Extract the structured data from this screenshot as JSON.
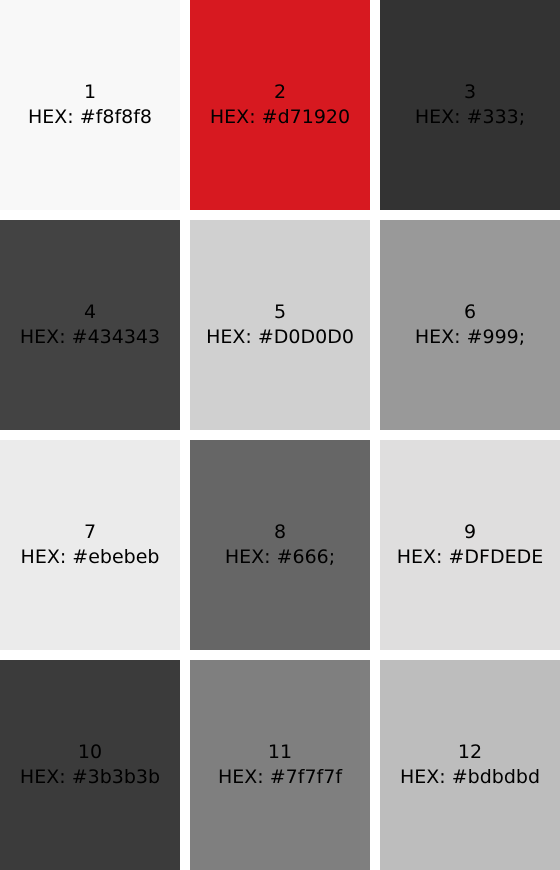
{
  "hex_prefix": "HEX:",
  "swatches": [
    {
      "number": "1",
      "hex": "#f8f8f8",
      "color": "#f8f8f8"
    },
    {
      "number": "2",
      "hex": "#d71920",
      "color": "#d71920"
    },
    {
      "number": "3",
      "hex": "#333;",
      "color": "#333333"
    },
    {
      "number": "4",
      "hex": "#434343",
      "color": "#434343"
    },
    {
      "number": "5",
      "hex": "#D0D0D0",
      "color": "#d0d0d0"
    },
    {
      "number": "6",
      "hex": "#999;",
      "color": "#999999"
    },
    {
      "number": "7",
      "hex": "#ebebeb",
      "color": "#ebebeb"
    },
    {
      "number": "8",
      "hex": "#666;",
      "color": "#666666"
    },
    {
      "number": "9",
      "hex": "#DFDEDE",
      "color": "#dfdede"
    },
    {
      "number": "10",
      "hex": "#3b3b3b",
      "color": "#3b3b3b"
    },
    {
      "number": "11",
      "hex": "#7f7f7f",
      "color": "#7f7f7f"
    },
    {
      "number": "12",
      "hex": "#bdbdbd",
      "color": "#bdbdbd"
    }
  ]
}
